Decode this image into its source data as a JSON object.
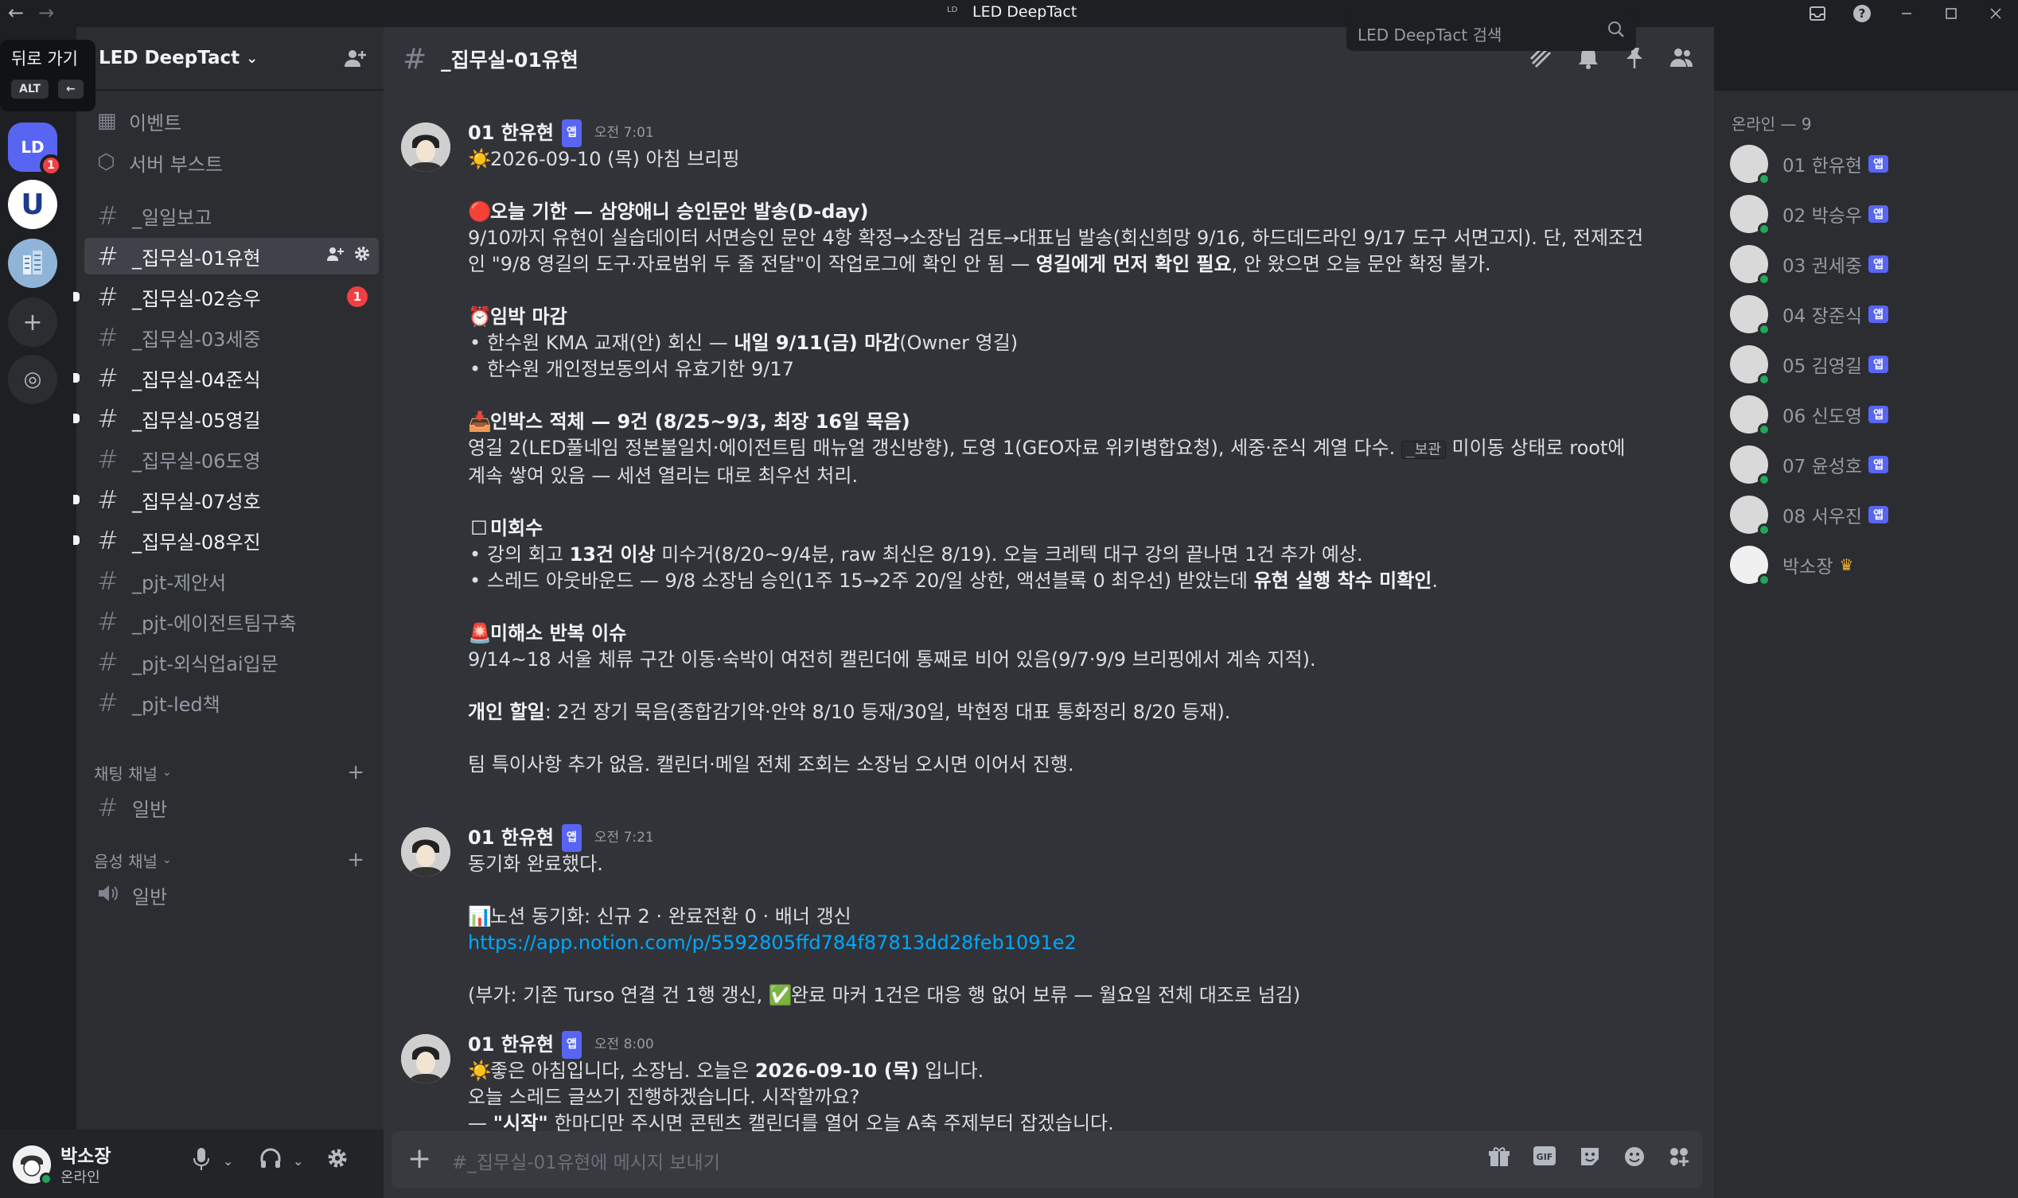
{
  "window": {
    "title": "LED DeepTact",
    "logo_text": "LD",
    "back_icon": "←",
    "forward_icon": "→"
  },
  "tooltip": {
    "text": "뒤로 가기",
    "key": "ALT",
    "arrow": "←"
  },
  "servers": {
    "ld_label": "LD",
    "ld_badge": "1",
    "u_label": "U",
    "add_icon": "+",
    "explore_icon": "◎"
  },
  "sidebar": {
    "server_name": "LED DeepTact",
    "chevron": "⌄",
    "items": [
      {
        "icon": "▦",
        "label": "이벤트"
      },
      {
        "icon": "⬡",
        "label": "서버 부스트"
      }
    ],
    "channels": [
      {
        "label": "_일일보고"
      },
      {
        "label": "_집무실-01유현"
      },
      {
        "label": "_집무실-02승우",
        "mention": "1"
      },
      {
        "label": "_집무실-03세중"
      },
      {
        "label": "_집무실-04준식"
      },
      {
        "label": "_집무실-05영길"
      },
      {
        "label": "_집무실-06도영"
      },
      {
        "label": "_집무실-07성호"
      },
      {
        "label": "_집무실-08우진"
      },
      {
        "label": "_pjt-제안서"
      },
      {
        "label": "_pjt-에이전트팀구축"
      },
      {
        "label": "_pjt-외식업ai입문"
      },
      {
        "label": "_pjt-led책"
      }
    ],
    "text_category": "채팅 채널",
    "text_channels": [
      {
        "label": "일반"
      }
    ],
    "voice_category": "음성 채널",
    "voice_channels": [
      {
        "label": "일반"
      }
    ]
  },
  "user": {
    "name": "박소장",
    "status": "온라인"
  },
  "channel": {
    "name": "_집무실-01유현",
    "search_placeholder": "LED DeepTact 검색",
    "composer_placeholder": "#_집무실-01유현에 메시지 보내기"
  },
  "messages": [
    {
      "author": "01 한유현",
      "tag": "앱",
      "time": "오전 7:01",
      "lines": {
        "l1": "2026-09-10 (목) 아침 브리핑",
        "h1": "오늘 기한 — 삼양애니 승인문안 발송(D-day)",
        "p1a": "9/10까지 유현이 실습데이터 서면승인 문안 4항 확정→소장님 검토→대표님 발송(회신희망 9/16, 하드데드라인 9/17 도구 서면고지). 단, 전제조건",
        "p1b": "인 \"9/8 영길의 도구·자료범위 두 줄 전달\"이 작업로그에 확인 안 됨 — ",
        "p1b_bold": "영길에게 먼저 확인 필요",
        "p1b_end": ", 안 왔으면 오늘 문안 확정 불가.",
        "h2": "임박 마감",
        "b2a": "한수원 KMA 교재(안) 회신 — ",
        "b2a_bold": "내일 9/11(금) 마감",
        "b2a_end": "(Owner 영길)",
        "b2b": "한수원 개인정보동의서 유효기한 9/17",
        "h3": "인박스 적체 — 9건 (8/25~9/3, 최장 16일 묵음)",
        "p3a": "영길 2(LED풀네임 정본불일치·에이전트팀 매뉴얼 갱신방향), 도영 1(GEO자료 위키병합요청), 세중·준식 계열 다수. ",
        "p3a_code": "_보관",
        "p3a_end": " 미이동 상태로 root에",
        "p3b": "계속 쌓여 있음 — 세션 열리는 대로 최우선 처리.",
        "h4": "미회수",
        "b4a": "강의 회고 ",
        "b4a_bold": "13건 이상",
        "b4a_end": " 미수거(8/20~9/4분, raw 최신은 8/19). 오늘 크레텍 대구 강의 끝나면 1건 추가 예상.",
        "b4b": "스레드 아웃바운드 — 9/8 소장님 승인(1주 15→2주 20/일 상한, 액션블록 0 최우선) 받았는데 ",
        "b4b_bold": "유현 실행 착수 미확인",
        "b4b_end": ".",
        "h5": "미해소 반복 이슈",
        "p5": "9/14~18 서울 체류 구간 이동·숙박이 여전히 캘린더에 통째로 비어 있음(9/7·9/9 브리핑에서 계속 지적).",
        "p6_bold": "개인 할일",
        "p6": ": 2건 장기 묵음(종합감기약·안약 8/10 등재/30일, 박현정 대표 통화정리 8/20 등재).",
        "p7": "팀 특이사항 추가 없음. 캘린더·메일 전체 조회는 소장님 오시면 이어서 진행."
      }
    },
    {
      "author": "01 한유현",
      "tag": "앱",
      "time": "오전 7:21",
      "lines": {
        "l1": "동기화 완료했다.",
        "l2": "노션 동기화: 신규 2 · 완료전환 0 · 배너 갱신",
        "link": "https://app.notion.com/p/5592805ffd784f87813dd28feb1091e2",
        "l3a": "(부가: 기존 Turso 연결 건 1행 갱신, ",
        "l3b": "완료 마커 1건은 대응 행 없어 보류 — 월요일 전체 대조로 넘김)"
      }
    },
    {
      "author": "01 한유현",
      "tag": "앱",
      "time": "오전 8:00",
      "lines": {
        "l1a": "좋은 아침입니다, 소장님. 오늘은 ",
        "l1_bold": "2026-09-10 (목)",
        "l1b": " 입니다.",
        "l2": "오늘 스레드 글쓰기 진행하겠습니다. 시작할까요?",
        "l3a": "— ",
        "l3_bold": "\"시작\"",
        "l3b": " 한마디만 주시면 콘텐츠 캘린더를 열어 오늘 A축 주제부터 잡겠습니다."
      }
    }
  ],
  "members": {
    "header": "온라인 — 9",
    "list": [
      {
        "name": "01 한유현",
        "tag": "앱"
      },
      {
        "name": "02 박승우",
        "tag": "앱"
      },
      {
        "name": "03 권세중",
        "tag": "앱"
      },
      {
        "name": "04 장준식",
        "tag": "앱"
      },
      {
        "name": "05 김영길",
        "tag": "앱"
      },
      {
        "name": "06 신도영",
        "tag": "앱"
      },
      {
        "name": "07 윤성호",
        "tag": "앱"
      },
      {
        "name": "08 서우진",
        "tag": "앱"
      },
      {
        "name": "박소장",
        "crown": "♛"
      }
    ]
  },
  "colors": {
    "accent": "#5865f2",
    "online": "#23a55a",
    "mention": "#f23f43",
    "link": "#00a8fc"
  }
}
